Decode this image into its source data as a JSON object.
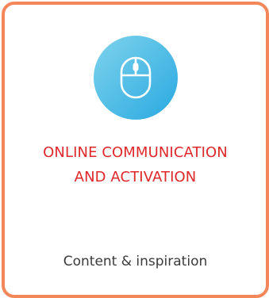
{
  "card": {
    "icon": "mouse-icon",
    "title_line1": "ONLINE COMMUNICATION",
    "title_line2": "AND ACTIVATION",
    "subtitle": "Content & inspiration"
  },
  "colors": {
    "border": "#f3875a",
    "title": "#e0282b",
    "subtitle": "#3a3a3a",
    "icon_gradient_start": "#7fd3ec",
    "icon_gradient_end": "#29a9e1"
  }
}
